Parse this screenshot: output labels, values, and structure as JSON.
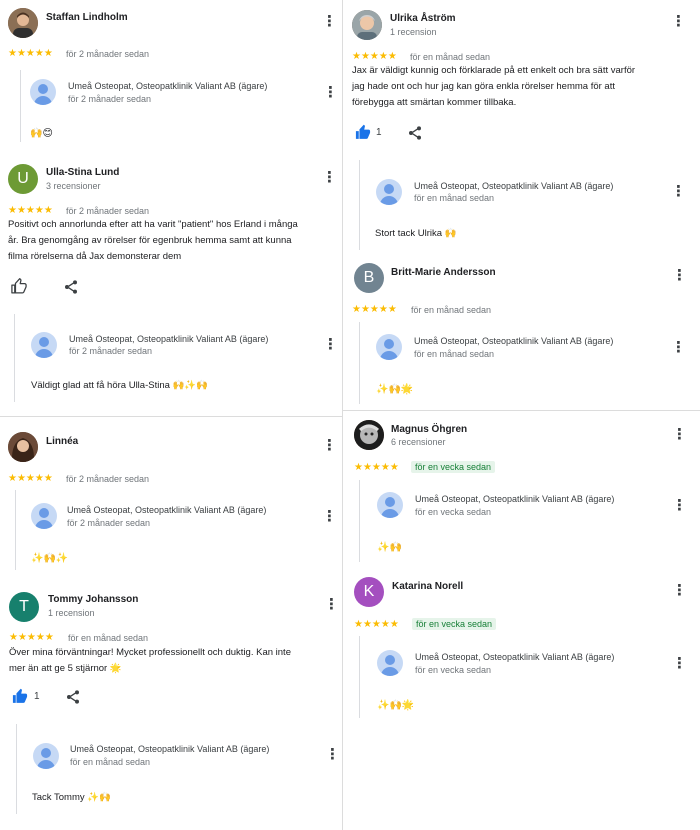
{
  "owner": {
    "name": "Umeå Osteopat, Osteopatklinik Valiant AB (ägare)"
  },
  "reviews": [
    {
      "name": "Staffan Lindholm",
      "subtitle": "",
      "stars": "★★★★★",
      "date": "för 2 månader sedan",
      "text": "",
      "likes": "",
      "reply_date": "för 2 månader sedan",
      "reply_text": "🙌😊"
    },
    {
      "name": "Ulla-Stina Lund",
      "initial": "U",
      "subtitle": "3 recensioner",
      "stars": "★★★★★",
      "date": "för 2 månader sedan",
      "text_lines": [
        "Positivt och annorlunda efter att ha varit \"patient\" hos Erland i många",
        "år. Bra genomgång av rörelser för egenbruk hemma samt att kunna",
        "filma rörelserna då Jax demonsterar dem"
      ],
      "likes": "",
      "reply_date": "för 2 månader sedan",
      "reply_text": "Väldigt glad att få höra Ulla-Stina 🙌✨🙌"
    },
    {
      "name": "Linnéa",
      "subtitle": "",
      "stars": "★★★★★",
      "date": "för 2 månader sedan",
      "likes": "",
      "reply_date": "för 2 månader sedan",
      "reply_text": "✨🙌✨"
    },
    {
      "name": "Tommy Johansson",
      "initial": "T",
      "subtitle": "1 recension",
      "stars": "★★★★★",
      "date": "för en månad sedan",
      "text_lines": [
        "Över mina förväntningar! Mycket professionellt och duktig. Kan inte",
        "mer än att ge 5 stjärnor 🌟"
      ],
      "likes": "1",
      "reply_date": "för en månad sedan",
      "reply_text": "Tack Tommy ✨🙌"
    },
    {
      "name": "Ulrika Åström",
      "subtitle": "1 recension",
      "stars": "★★★★★",
      "date": "för en månad sedan",
      "text_lines": [
        "Jax är väldigt kunnig och förklarade på ett enkelt och bra sätt varför",
        "jag hade ont och hur jag kan göra enkla rörelser hemma för att",
        "förebygga att smärtan kommer tillbaka."
      ],
      "likes": "1",
      "reply_date": "för en månad sedan",
      "reply_text": "Stort tack Ulrika 🙌"
    },
    {
      "name": "Britt-Marie Andersson",
      "initial": "B",
      "subtitle": "",
      "stars": "★★★★★",
      "date": "för en månad sedan",
      "likes": "",
      "reply_date": "för en månad sedan",
      "reply_text": "✨🙌🌟"
    },
    {
      "name": "Magnus Öhgren",
      "subtitle": "6 recensioner",
      "stars": "★★★★★",
      "date": "för en vecka sedan",
      "likes": "",
      "reply_date": "för en vecka sedan",
      "reply_text": "✨🙌"
    },
    {
      "name": "Katarina Norell",
      "initial": "K",
      "subtitle": "",
      "stars": "★★★★★",
      "date": "för en vecka sedan",
      "likes": "",
      "reply_date": "för en vecka sedan",
      "reply_text": "✨🙌🌟"
    }
  ],
  "icons": {
    "more": "more-vert-icon",
    "like": "thumbs-up-icon",
    "share": "share-icon"
  },
  "colors": {
    "star": "#fbbc04",
    "like_active": "#1a73e8",
    "new_badge_bg": "#e6f4ea",
    "new_badge_text": "#188038"
  }
}
